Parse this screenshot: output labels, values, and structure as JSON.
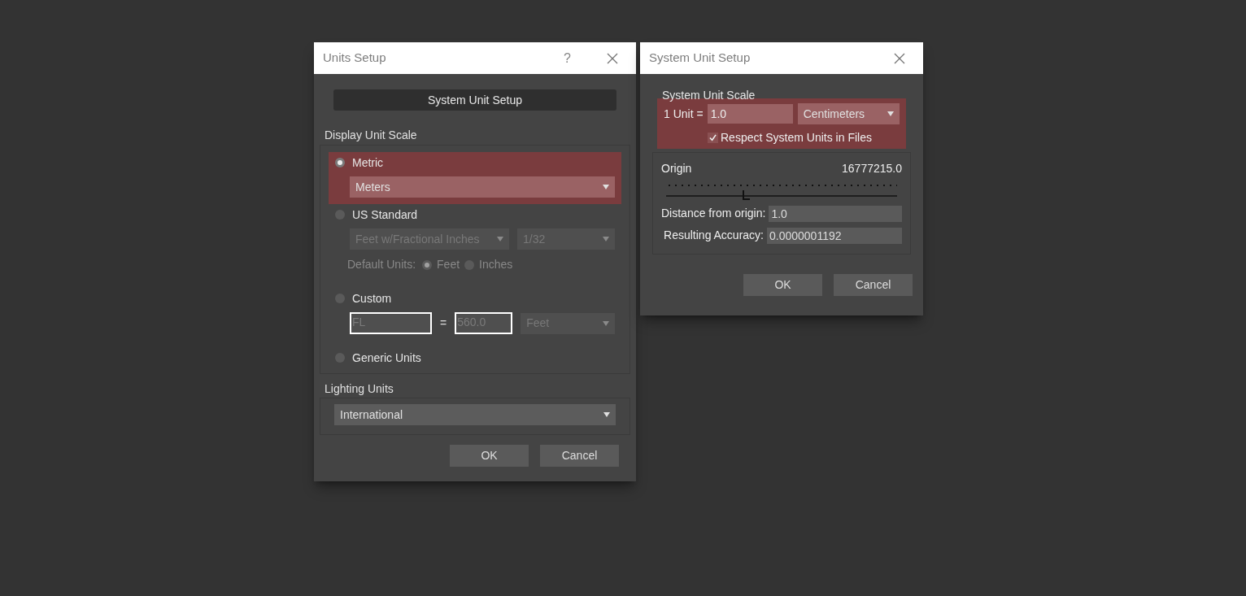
{
  "units_dialog": {
    "title": "Units Setup",
    "help": "?",
    "system_unit_setup_button": "System Unit Setup",
    "display_unit_scale": {
      "label": "Display Unit Scale",
      "options": [
        {
          "kind": "metric",
          "label": "Metric",
          "selected": true,
          "highlighted": true,
          "disabled": false,
          "dropdown": "Meters"
        },
        {
          "kind": "us",
          "label": "US Standard",
          "selected": false,
          "highlighted": false,
          "disabled": true,
          "dropdowns": [
            "Feet w/Fractional Inches",
            "1/32"
          ],
          "default_units_label": "Default Units:",
          "default_units": [
            {
              "label": "Feet",
              "selected": true
            },
            {
              "label": "Inches",
              "selected": false
            }
          ]
        },
        {
          "kind": "custom",
          "label": "Custom",
          "selected": false,
          "highlighted": false,
          "disabled": true,
          "fields": [
            "FL",
            "560.0"
          ],
          "equals": "=",
          "dropdown": "Feet"
        },
        {
          "kind": "generic",
          "label": "Generic Units",
          "selected": false,
          "highlighted": false
        }
      ]
    },
    "lighting_units": {
      "label": "Lighting Units",
      "dropdown": "International"
    },
    "buttons": [
      "OK",
      "Cancel"
    ]
  },
  "system_unit_dialog": {
    "title": "System Unit Setup",
    "system_unit_scale": {
      "label": "System Unit Scale",
      "highlighted": true,
      "unit_label": "1 Unit =",
      "value": "1.0",
      "unit": "Centimeters",
      "checkbox": {
        "label": "Respect System Units in Files",
        "checked": true
      }
    },
    "origin": {
      "label": "Origin",
      "reading": "16777215.0",
      "level": 0.33
    },
    "fields": [
      {
        "label": "Distance from origin:",
        "value": "1.0"
      },
      {
        "label": "Resulting Accuracy:",
        "value": "0.0000001192"
      }
    ],
    "buttons": [
      "OK",
      "Cancel"
    ]
  }
}
